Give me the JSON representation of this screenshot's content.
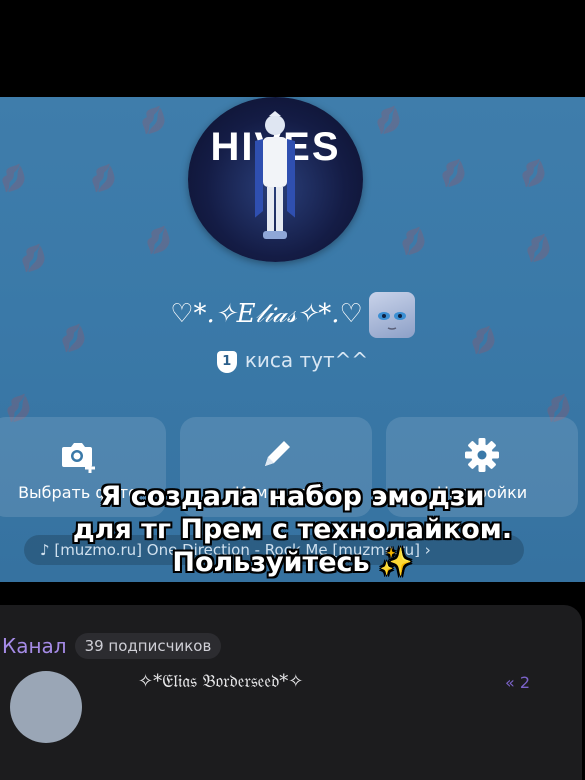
{
  "profile": {
    "avatar_brand": "HIVES",
    "display_name": "♡*.✧𝐸𝓁𝒾𝒶𝓈✧*.♡",
    "status_badge": "1",
    "status_text": "киса тут^^"
  },
  "actions": [
    {
      "label": "Выбрать фото",
      "icon": "camera-add-icon"
    },
    {
      "label": "Изменить",
      "icon": "pencil-icon"
    },
    {
      "label": "Настройки",
      "icon": "gear-icon"
    }
  ],
  "music": {
    "track": "[muzmo.ru] One Direction - Rock Me [muzmo.ru]",
    "icon": "music-note-icon"
  },
  "caption": {
    "line1": "Я создала набор эмодзи",
    "line2": "для тг Прем с технолайком.",
    "line3": "Пользуйтесь ✨"
  },
  "channel": {
    "title": "Канал",
    "subscribers": "39 подписчиков",
    "post_title": "✧*𝔈𝔩𝔦𝔞𝔰 𝔅𝔬𝔯𝔡𝔢𝔯𝔰𝔢𝔢𝔡*✧",
    "post_meta": "« 2"
  },
  "colors": {
    "accent": "#a58be6",
    "profile_bg": "#3f7dab",
    "card_bg": "#1c1c1e"
  }
}
